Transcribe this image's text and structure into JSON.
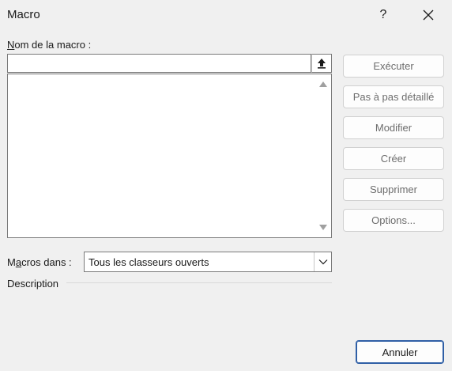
{
  "window": {
    "title": "Macro",
    "help_label": "?"
  },
  "form": {
    "name_label_first": "N",
    "name_label_rest": "om de la macro :",
    "name_value": "",
    "macros_in_label_first": "M",
    "macros_in_label_mid": "a",
    "macros_in_label_rest": "cros dans :",
    "macros_in_value": "Tous les classeurs ouverts",
    "description_label": "Description"
  },
  "buttons": {
    "run": "Exécuter",
    "step_into": "Pas à pas détaillé",
    "edit": "Modifier",
    "create": "Créer",
    "delete": "Supprimer",
    "options": "Options...",
    "cancel": "Annuler"
  },
  "icons": {
    "close": "close-icon",
    "up_arrow": "upload-arrow-icon",
    "dropdown": "chevron-down-icon"
  }
}
